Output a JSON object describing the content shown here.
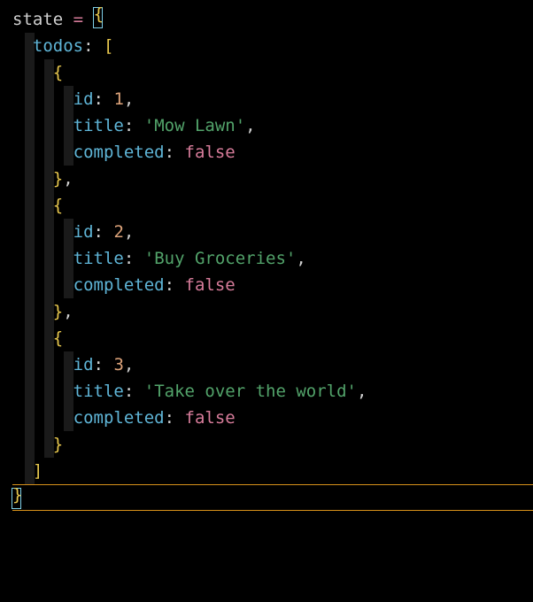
{
  "code": {
    "varName": "state",
    "assign": "=",
    "openBrace": "{",
    "closeBrace": "}",
    "openBracket": "[",
    "closeBracket": "]",
    "comma": ",",
    "colon": ":",
    "todosKey": "todos",
    "idKey": "id",
    "titleKey": "title",
    "completedKey": "completed",
    "falseVal": "false",
    "items": [
      {
        "id": "1",
        "title": "'Mow Lawn'"
      },
      {
        "id": "2",
        "title": "'Buy Groceries'"
      },
      {
        "id": "3",
        "title": "'Take over the world'"
      }
    ]
  }
}
